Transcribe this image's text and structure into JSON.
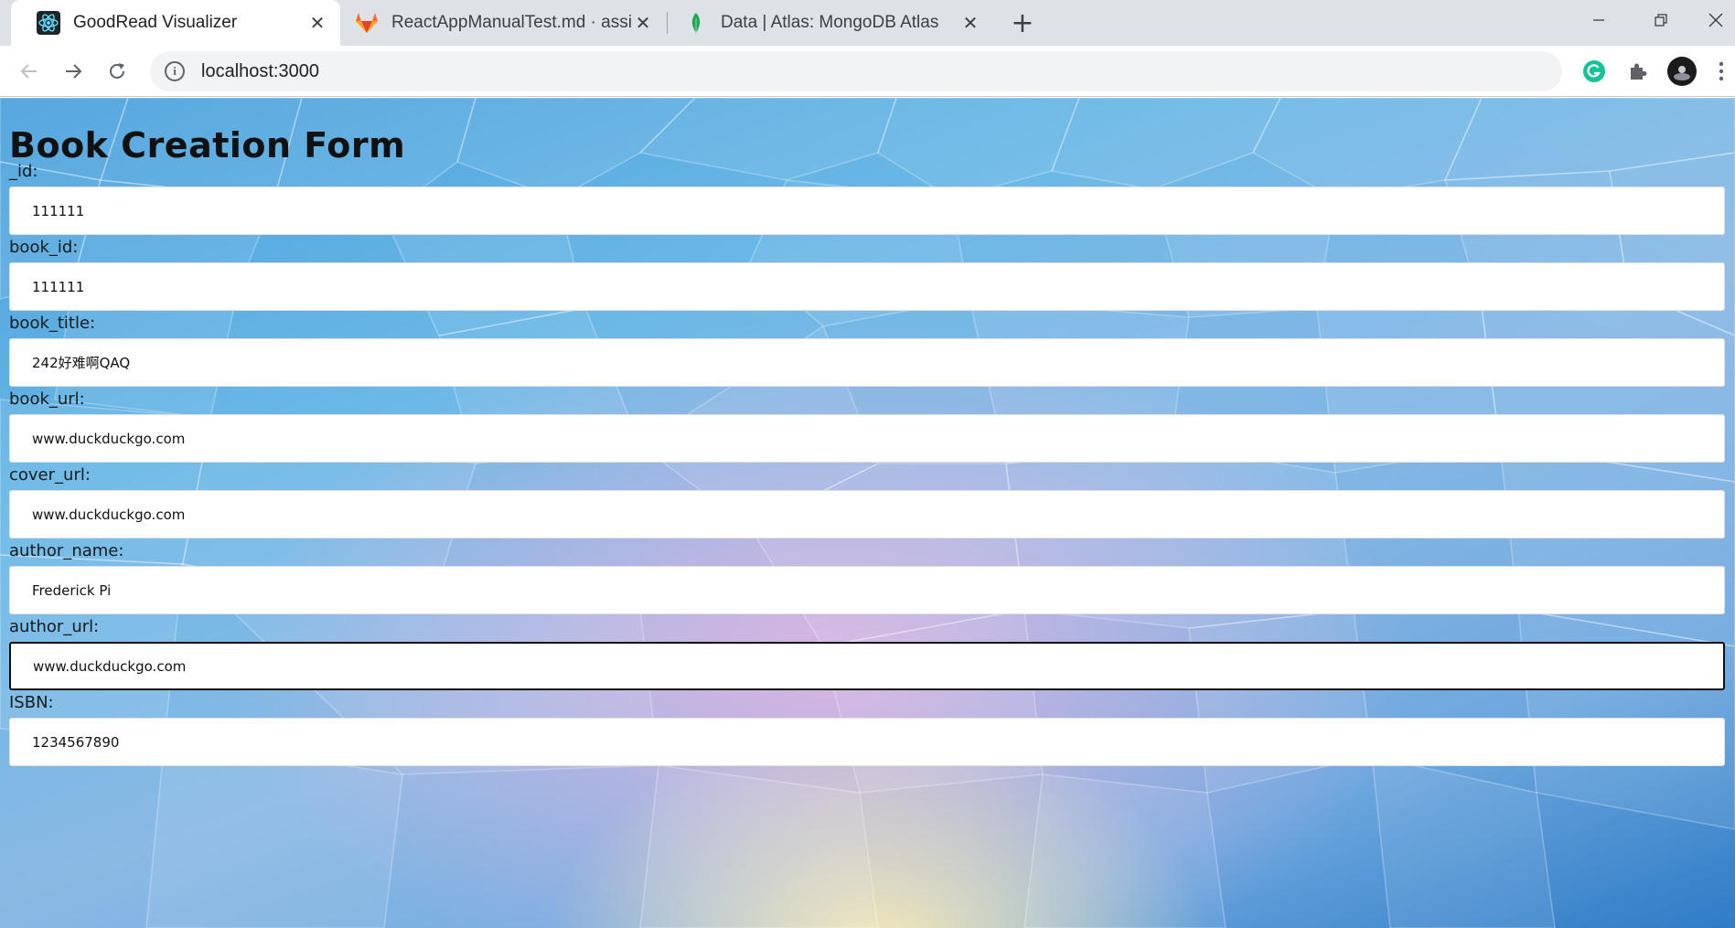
{
  "browser": {
    "tabs": [
      {
        "title": "GoodRead Visualizer",
        "icon": "react-icon",
        "active": true
      },
      {
        "title": "ReactAppManualTest.md · assignment",
        "icon": "gitlab-icon",
        "active": false
      },
      {
        "title": "Data | Atlas: MongoDB Atlas",
        "icon": "mongodb-leaf-icon",
        "active": false
      }
    ],
    "url": "localhost:3000"
  },
  "form": {
    "title": "Book Creation Form",
    "fields": [
      {
        "label": "_id:",
        "value": "111111"
      },
      {
        "label": "book_id:",
        "value": "111111"
      },
      {
        "label": "book_title:",
        "value": "242好难啊QAQ"
      },
      {
        "label": "book_url:",
        "value": "www.duckduckgo.com"
      },
      {
        "label": "cover_url:",
        "value": "www.duckduckgo.com"
      },
      {
        "label": "author_name:",
        "value": "Frederick Pi"
      },
      {
        "label": "author_url:",
        "value": "www.duckduckgo.com"
      },
      {
        "label": "ISBN:",
        "value": "1234567890"
      }
    ]
  }
}
